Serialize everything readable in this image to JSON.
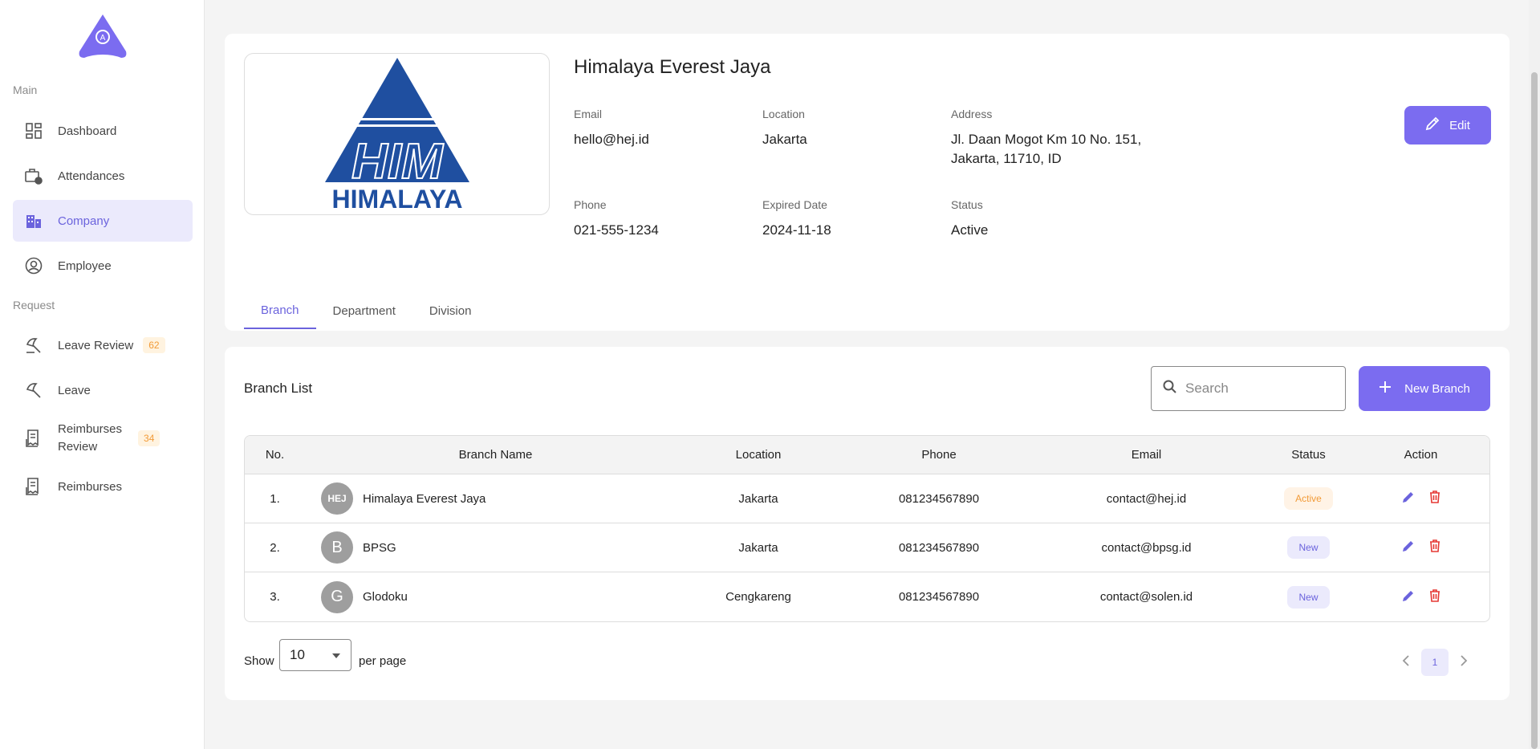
{
  "sidebar": {
    "section_main": "Main",
    "section_request": "Request",
    "items": [
      {
        "label": "Dashboard"
      },
      {
        "label": "Attendances"
      },
      {
        "label": "Company"
      },
      {
        "label": "Employee"
      },
      {
        "label": "Leave Review",
        "badge": "62"
      },
      {
        "label": "Leave"
      },
      {
        "label": "Reimburses Review",
        "line1": "Reimburses",
        "line2": "Review",
        "badge": "34"
      },
      {
        "label": "Reimburses"
      }
    ]
  },
  "company": {
    "name": "Himalaya Everest Jaya",
    "logo_top": "HIM",
    "logo_text": "HIMALAYA",
    "email_label": "Email",
    "email": "hello@hej.id",
    "location_label": "Location",
    "location": "Jakarta",
    "address_label": "Address",
    "address_line1": "Jl. Daan Mogot Km 10 No. 151,",
    "address_line2": "Jakarta, 11710, ID",
    "phone_label": "Phone",
    "phone": "021-555-1234",
    "expired_label": "Expired Date",
    "expired": "2024-11-18",
    "status_label": "Status",
    "status": "Active",
    "edit_label": "Edit"
  },
  "tabs": [
    {
      "label": "Branch",
      "active": true
    },
    {
      "label": "Department"
    },
    {
      "label": "Division"
    }
  ],
  "branch_list": {
    "title": "Branch List",
    "search_placeholder": "Search",
    "new_button": "New Branch",
    "columns": [
      "No.",
      "Branch Name",
      "Location",
      "Phone",
      "Email",
      "Status",
      "Action"
    ],
    "rows": [
      {
        "no": "1.",
        "initials": "HEJ",
        "name": "Himalaya Everest Jaya",
        "location": "Jakarta",
        "phone": "081234567890",
        "email": "contact@hej.id",
        "status": "Active"
      },
      {
        "no": "2.",
        "initials": "B",
        "name": "BPSG",
        "location": "Jakarta",
        "phone": "081234567890",
        "email": "contact@bpsg.id",
        "status": "New"
      },
      {
        "no": "3.",
        "initials": "G",
        "name": "Glodoku",
        "location": "Cengkareng",
        "phone": "081234567890",
        "email": "contact@solen.id",
        "status": "New"
      }
    ]
  },
  "pagination": {
    "show_label": "Show",
    "per_page_value": "10",
    "per_page_label": "per page",
    "current_page": "1"
  },
  "colors": {
    "accent": "#7b6cf0",
    "accent_text": "#6b63dd",
    "badge_orange": "#f29b38",
    "delete_red": "#e53935",
    "logo_blue": "#1f4fa0"
  }
}
